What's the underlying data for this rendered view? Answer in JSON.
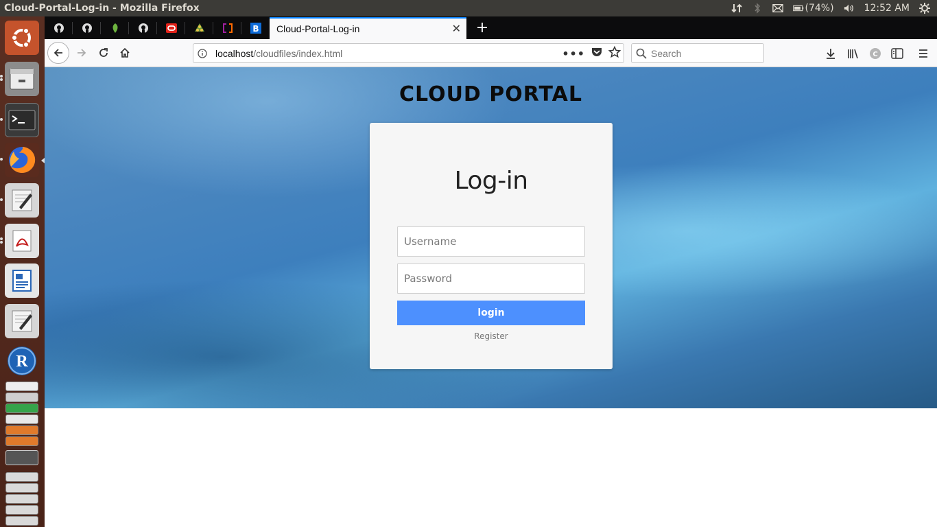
{
  "system_panel": {
    "window_title": "Cloud-Portal-Log-in - Mozilla Firefox",
    "battery_text": "(74%)",
    "clock": "12:52 AM",
    "icons": [
      "network-updown-icon",
      "bluetooth-icon",
      "mail-icon",
      "battery-icon",
      "volume-icon",
      "settings-gear-icon"
    ]
  },
  "launcher": {
    "items": [
      {
        "name": "ubuntu-dash-icon",
        "color": "#e95420"
      },
      {
        "name": "file-manager-icon",
        "color": "#a0a0a0"
      },
      {
        "name": "terminal-icon",
        "color": "#2c2c2c"
      },
      {
        "name": "firefox-icon",
        "color": "#ff7139"
      },
      {
        "name": "text-editor-icon",
        "color": "#d8d8d8"
      },
      {
        "name": "pdf-viewer-icon",
        "color": "#e8e8e8"
      },
      {
        "name": "libreoffice-writer-icon",
        "color": "#2a66b7"
      },
      {
        "name": "text-editor-2-icon",
        "color": "#d8d8d8"
      },
      {
        "name": "r-language-icon",
        "color": "#1e63b5"
      }
    ]
  },
  "browser": {
    "pinned_tabs": [
      {
        "name": "github-tab-icon"
      },
      {
        "name": "github-tab-icon"
      },
      {
        "name": "leaf-tab-icon"
      },
      {
        "name": "github-tab-icon"
      },
      {
        "name": "oracle-tab-icon"
      },
      {
        "name": "tree-tab-icon"
      },
      {
        "name": "bracket-tab-icon"
      },
      {
        "name": "b-tab-icon"
      }
    ],
    "active_tab": {
      "title": "Cloud-Portal-Log-in"
    },
    "url": {
      "host": "localhost",
      "path": "/cloudfiles/index.html"
    },
    "search_placeholder": "Search"
  },
  "page": {
    "portal_title": "CLOUD PORTAL",
    "login": {
      "heading": "Log-in",
      "username_placeholder": "Username",
      "password_placeholder": "Password",
      "button_label": "login",
      "register_label": "Register"
    }
  },
  "colors": {
    "accent": "#0a84ff",
    "login_button": "#4d90fe"
  }
}
